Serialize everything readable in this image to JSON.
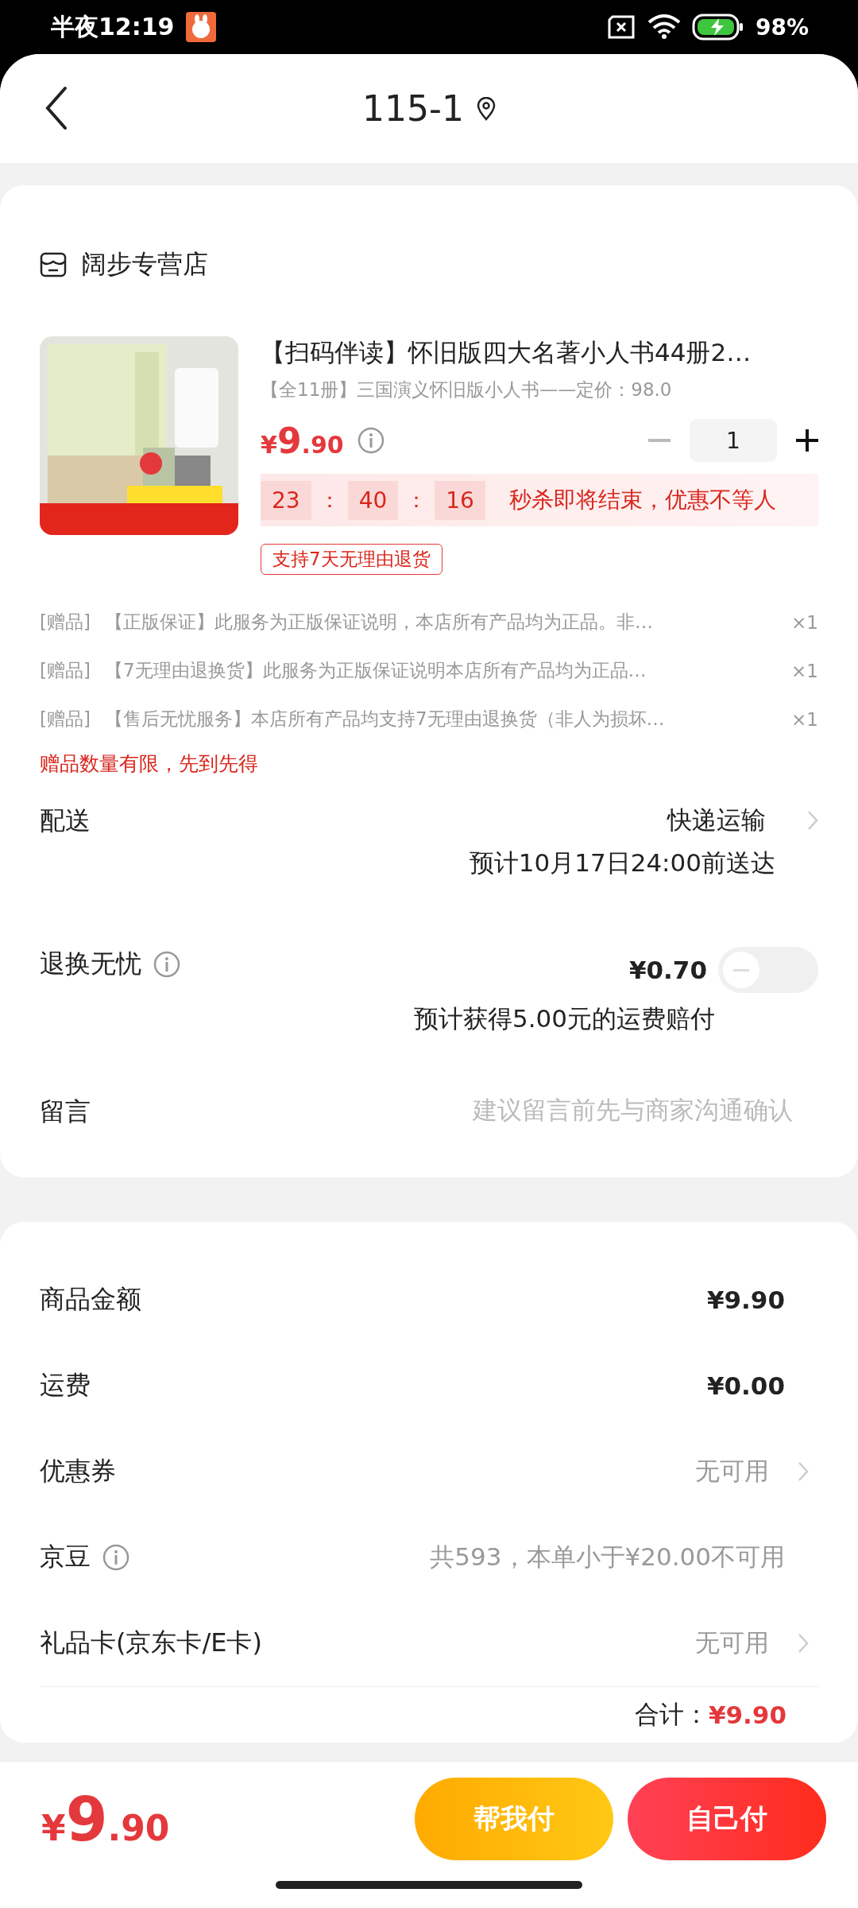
{
  "status_bar": {
    "time": "半夜12:19",
    "battery": "98%"
  },
  "header": {
    "title": "115-1"
  },
  "store": {
    "name": "阔步专营店"
  },
  "product": {
    "title": "【扫码伴读】怀旧版四大名著小人书44册2…",
    "subtitle": "【全11册】三国演义怀旧版小人书——定价：98.0",
    "price_symbol": "¥",
    "price_int": "9",
    "price_dec": ".90",
    "quantity": "1",
    "countdown": [
      "23",
      "40",
      "16"
    ],
    "countdown_sep": "：",
    "promo": "秒杀即将结束，优惠不等人",
    "tag": "支持7天无理由退货"
  },
  "gifts": [
    {
      "label": "[赠品]",
      "text": "【正版保证】此服务为正版保证说明，本店所有产品均为正品。非…",
      "count": "×1"
    },
    {
      "label": "[赠品]",
      "text": "【7无理由退换货】此服务为正版保证说明本店所有产品均为正品…",
      "count": "×1"
    },
    {
      "label": "[赠品]",
      "text": "【售后无忧服务】本店所有产品均支持7无理由退换货（非人为损坏…",
      "count": "×1"
    }
  ],
  "gift_note": "赠品数量有限，先到先得",
  "delivery": {
    "label": "配送",
    "value": "快递运输",
    "eta": "预计10月17日24:00前送达"
  },
  "return_insurance": {
    "label": "退换无忧",
    "price": "¥0.70",
    "on": false,
    "note": "预计获得5.00元的运费赔付"
  },
  "message": {
    "label": "留言",
    "placeholder": "建议留言前先与商家沟通确认"
  },
  "summary": [
    {
      "kind": "amount",
      "label": "商品金额",
      "value": "¥9.90"
    },
    {
      "kind": "amount",
      "label": "运费",
      "value": "¥0.00"
    },
    {
      "kind": "link",
      "label": "优惠券",
      "value": "无可用"
    },
    {
      "kind": "info",
      "label": "京豆",
      "value": "共593，本单小于¥20.00不可用"
    },
    {
      "kind": "link",
      "label": "礼品卡(京东卡/E卡)",
      "value": "无可用"
    }
  ],
  "total": {
    "label": "合计：",
    "value": "¥9.90"
  },
  "footer": {
    "price_symbol": "¥",
    "price_int": "9",
    "price_dec": ".90",
    "buttons": [
      {
        "kind": "friend",
        "label": "帮我付"
      },
      {
        "kind": "self",
        "label": "自己付"
      }
    ]
  }
}
